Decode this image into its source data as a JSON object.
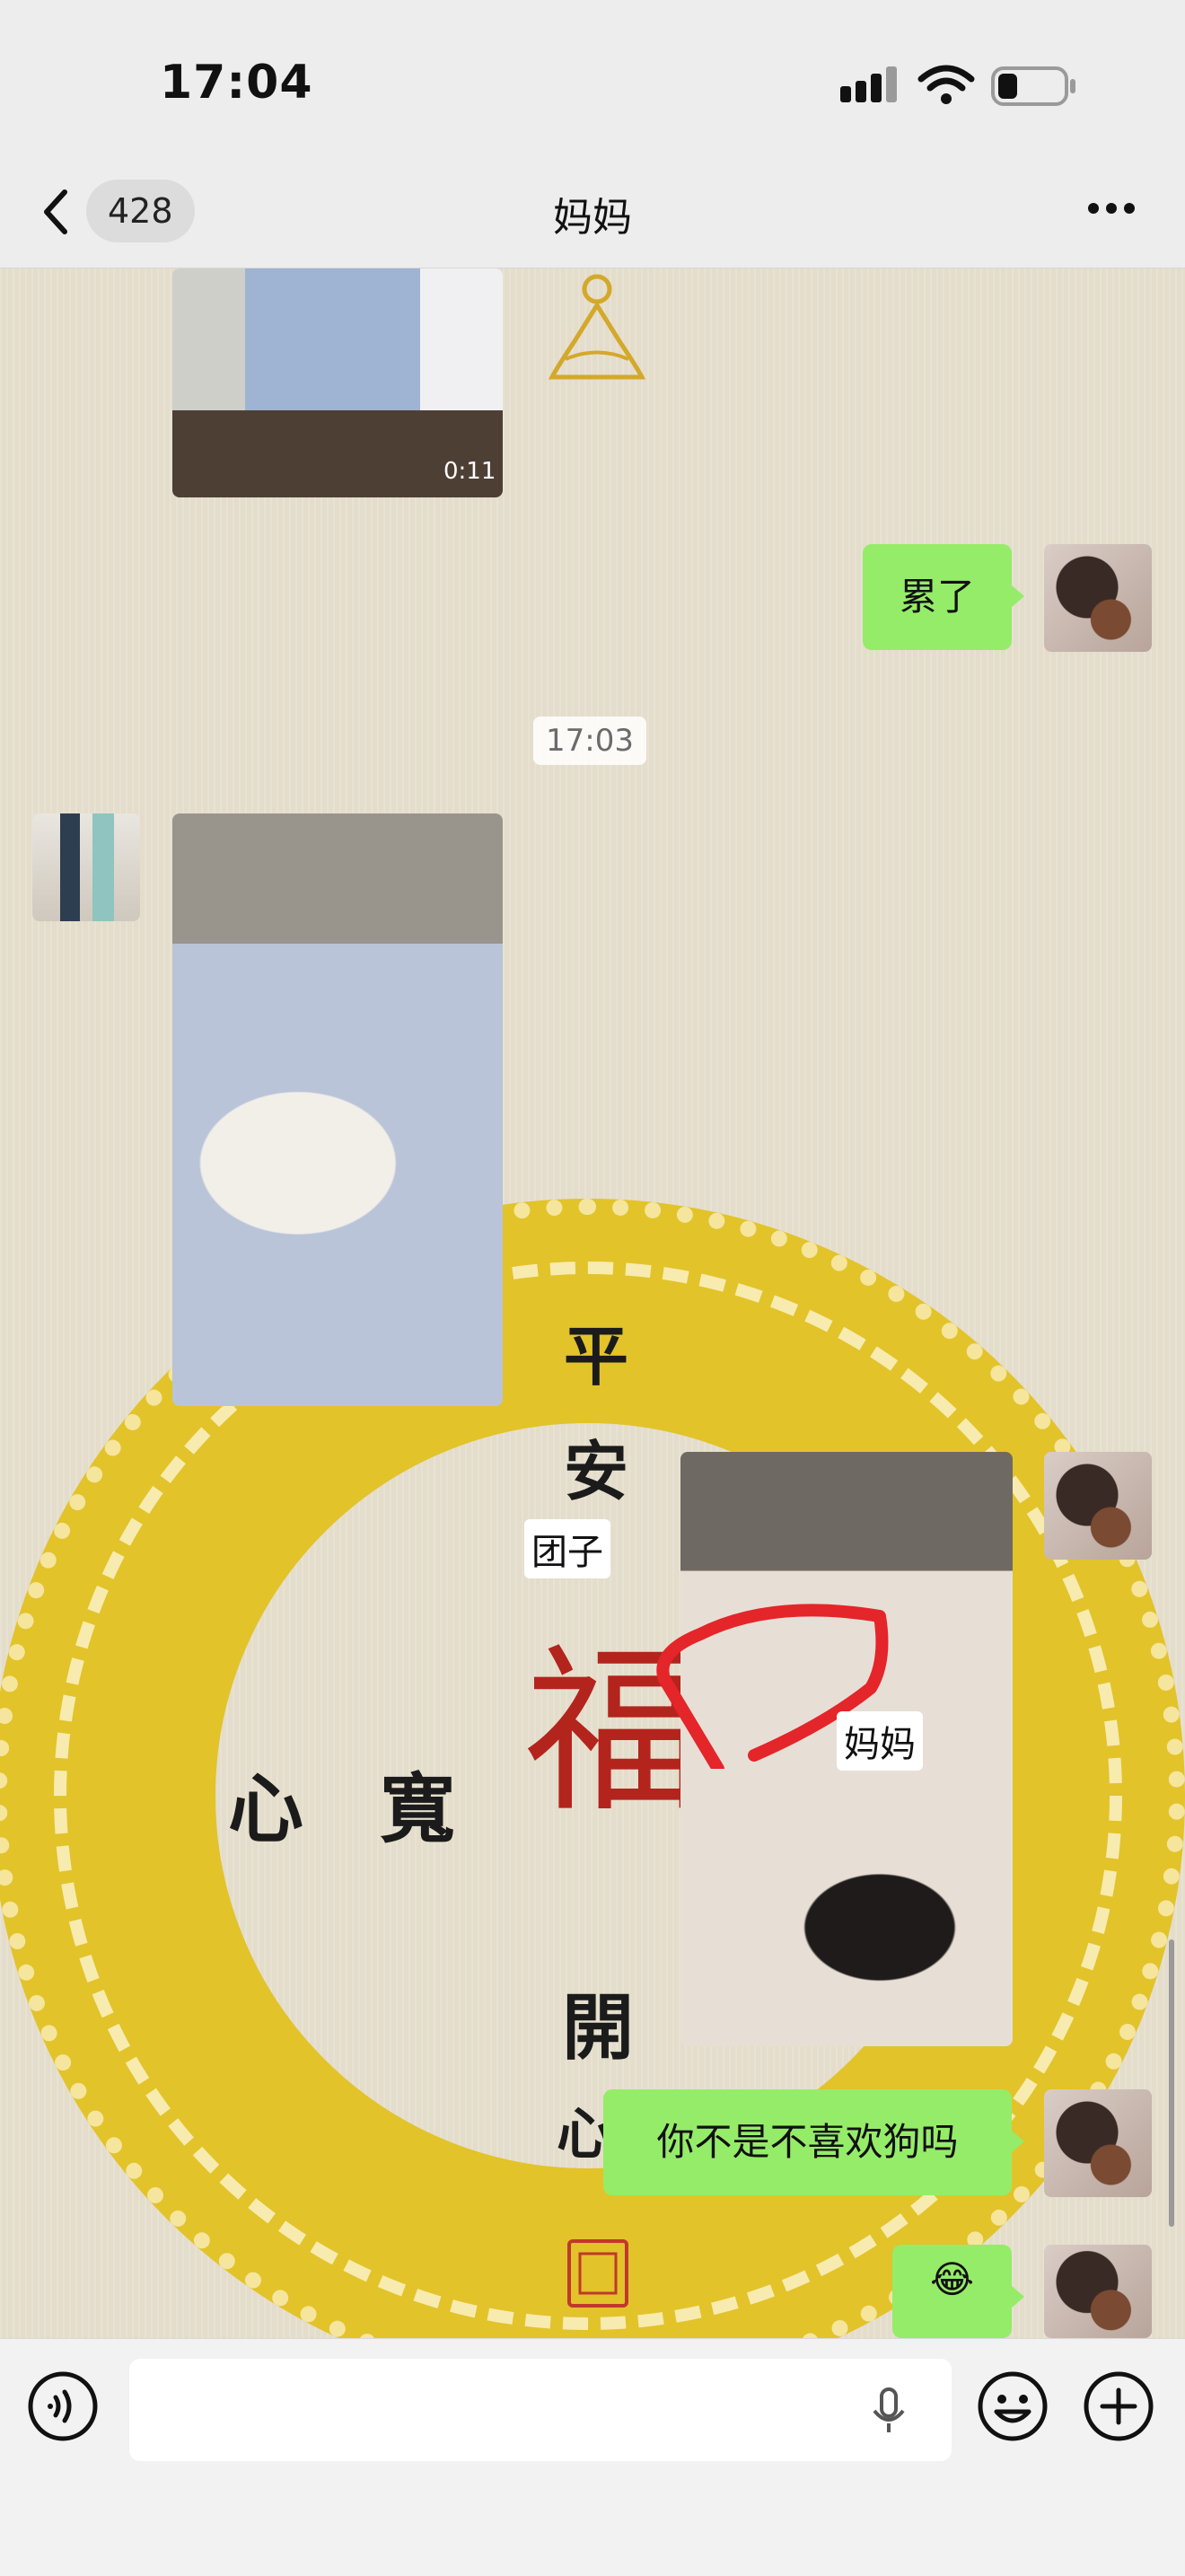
{
  "status_bar": {
    "time": "17:04",
    "battery_level": 0.3
  },
  "header": {
    "unread_count": "428",
    "title": "妈妈"
  },
  "chat": {
    "video": {
      "duration": "0:11"
    },
    "timestamp": "17:03",
    "messages": {
      "tired": "累了",
      "not_like_dogs": "你不是不喜欢狗吗",
      "emoji": "😂"
    },
    "photo_stickers": {
      "dog_label": "团子",
      "mom_label": "妈妈"
    }
  },
  "wallpaper": {
    "chars_vertical_top": [
      "平",
      "安"
    ],
    "char_fu": "福",
    "chars_vertical_bottom": [
      "開",
      "心"
    ],
    "chars_left": "心 寬"
  },
  "colors": {
    "bubble_out": "#95ec69",
    "wallpaper_gold": "#e2c32a",
    "fu_red": "#b3241d",
    "annotation_red": "#e4252a"
  }
}
